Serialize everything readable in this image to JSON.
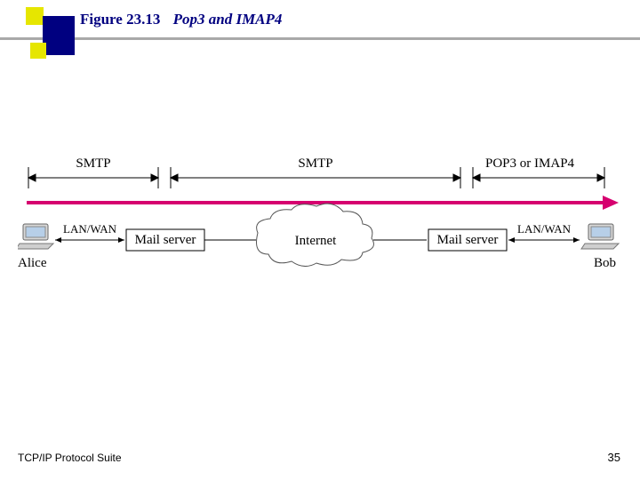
{
  "figure": {
    "number": "Figure 23.13",
    "caption": "Pop3 and IMAP4"
  },
  "protocols": {
    "seg1": "SMTP",
    "seg2": "SMTP",
    "seg3a": "POP3",
    "seg3_or": " or ",
    "seg3b": "IMAP4"
  },
  "links": {
    "left": "LAN/WAN",
    "right": "LAN/WAN"
  },
  "nodes": {
    "alice": "Alice",
    "mailserver1": "Mail server",
    "internet": "Internet",
    "mailserver2": "Mail server",
    "bob": "Bob"
  },
  "footer": {
    "left": "TCP/IP Protocol Suite",
    "page": "35"
  },
  "colors": {
    "accent": "#d6006f",
    "title": "#000080"
  }
}
